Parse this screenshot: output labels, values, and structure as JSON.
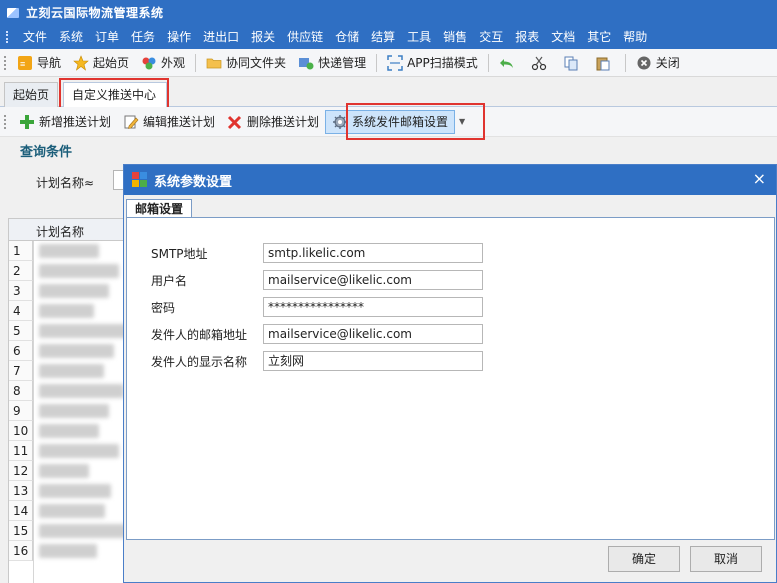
{
  "app": {
    "title": "立刻云国际物流管理系统"
  },
  "menu": [
    "文件",
    "系统",
    "订单",
    "任务",
    "操作",
    "进出口",
    "报关",
    "供应链",
    "仓储",
    "结算",
    "工具",
    "销售",
    "交互",
    "报表",
    "文档",
    "其它",
    "帮助"
  ],
  "toolbar": {
    "nav": "导航",
    "home": "起始页",
    "external": "外观",
    "shared_folder": "协同文件夹",
    "courier": "快递管理",
    "app_scan": "APP扫描模式",
    "close": "关闭"
  },
  "doc_tabs": {
    "home": "起始页",
    "push_center": "自定义推送中心"
  },
  "subtoolbar": {
    "add": "新增推送计划",
    "edit": "编辑推送计划",
    "delete": "删除推送计划",
    "mail_settings": "系统发件邮箱设置"
  },
  "query": {
    "title": "查询条件",
    "plan_name_label": "计划名称≈"
  },
  "grid": {
    "header": "计划名称",
    "row_numbers": [
      "1",
      "2",
      "3",
      "4",
      "5",
      "6",
      "7",
      "8",
      "9",
      "10",
      "11",
      "12",
      "13",
      "14",
      "15",
      "16"
    ]
  },
  "dialog": {
    "title": "系统参数设置",
    "close_glyph": "×",
    "tab": "邮箱设置",
    "fields": {
      "smtp_label": "SMTP地址",
      "smtp_value": "smtp.likelic.com",
      "user_label": "用户名",
      "user_value": "mailservice@likelic.com",
      "password_label": "密码",
      "password_value": "****************",
      "sender_label": "发件人的邮箱地址",
      "sender_value": "mailservice@likelic.com",
      "display_label": "发件人的显示名称",
      "display_value": "立刻网"
    },
    "ok": "确定",
    "cancel": "取消"
  },
  "colors": {
    "title_blue": "#2f6fc3",
    "highlight_red": "#e0342f",
    "active_button": "#cde4fb"
  }
}
